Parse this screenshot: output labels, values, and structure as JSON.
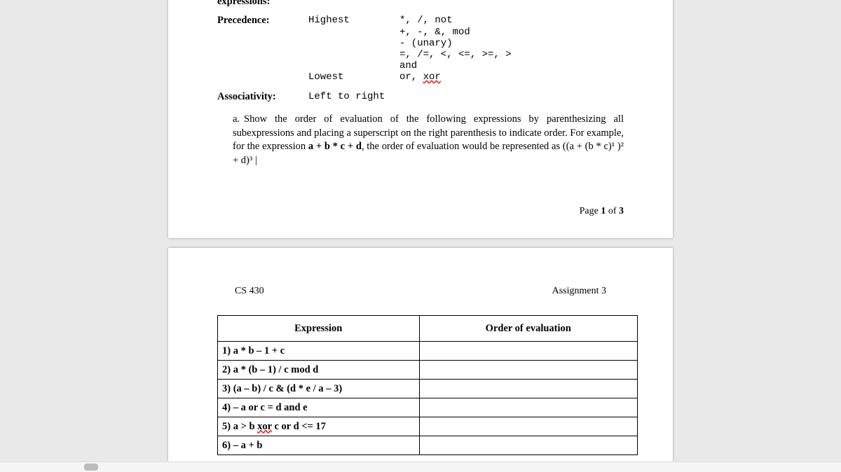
{
  "page1": {
    "expressions_label": "expressions:",
    "precedence_label": "Precedence:",
    "highest_label": "Highest",
    "lowest_label": "Lowest",
    "levels": [
      "*, /, not",
      "+, -, &, mod",
      "- (unary)",
      "=, /=, <, <=, >=, >",
      "and",
      "or, "
    ],
    "xor_token": "xor",
    "associativity_label": "Associativity:",
    "associativity_value": "Left to right",
    "question_marker": "a.",
    "question_text_1": "Show the order of evaluation of the following expressions by parenthesizing all subexpressions and placing a superscript on the right parenthesis to indicate order. For example, for the expression ",
    "question_expr_bold": "a + b * c + d",
    "question_text_2": ", the order of evaluation would be represented as ",
    "question_repr": "((a + (b * c)¹ )² + d)³ |",
    "footer_prefix": "Page ",
    "footer_page": "1",
    "footer_of": " of ",
    "footer_total": "3"
  },
  "page2": {
    "header_left": "CS 430",
    "header_right": "Assignment 3",
    "col_expr": "Expression",
    "col_order": "Order of evaluation",
    "rows": [
      "1) a * b – 1 + c",
      "2) a * (b – 1) / c mod d",
      "3) (a – b) / c & (d * e / a – 3)",
      "4) – a or c = d and e",
      "",
      "6) – a + b"
    ],
    "row5_prefix": "5) a > b ",
    "row5_xor": "xor",
    "row5_suffix": " c or d <= 17"
  }
}
